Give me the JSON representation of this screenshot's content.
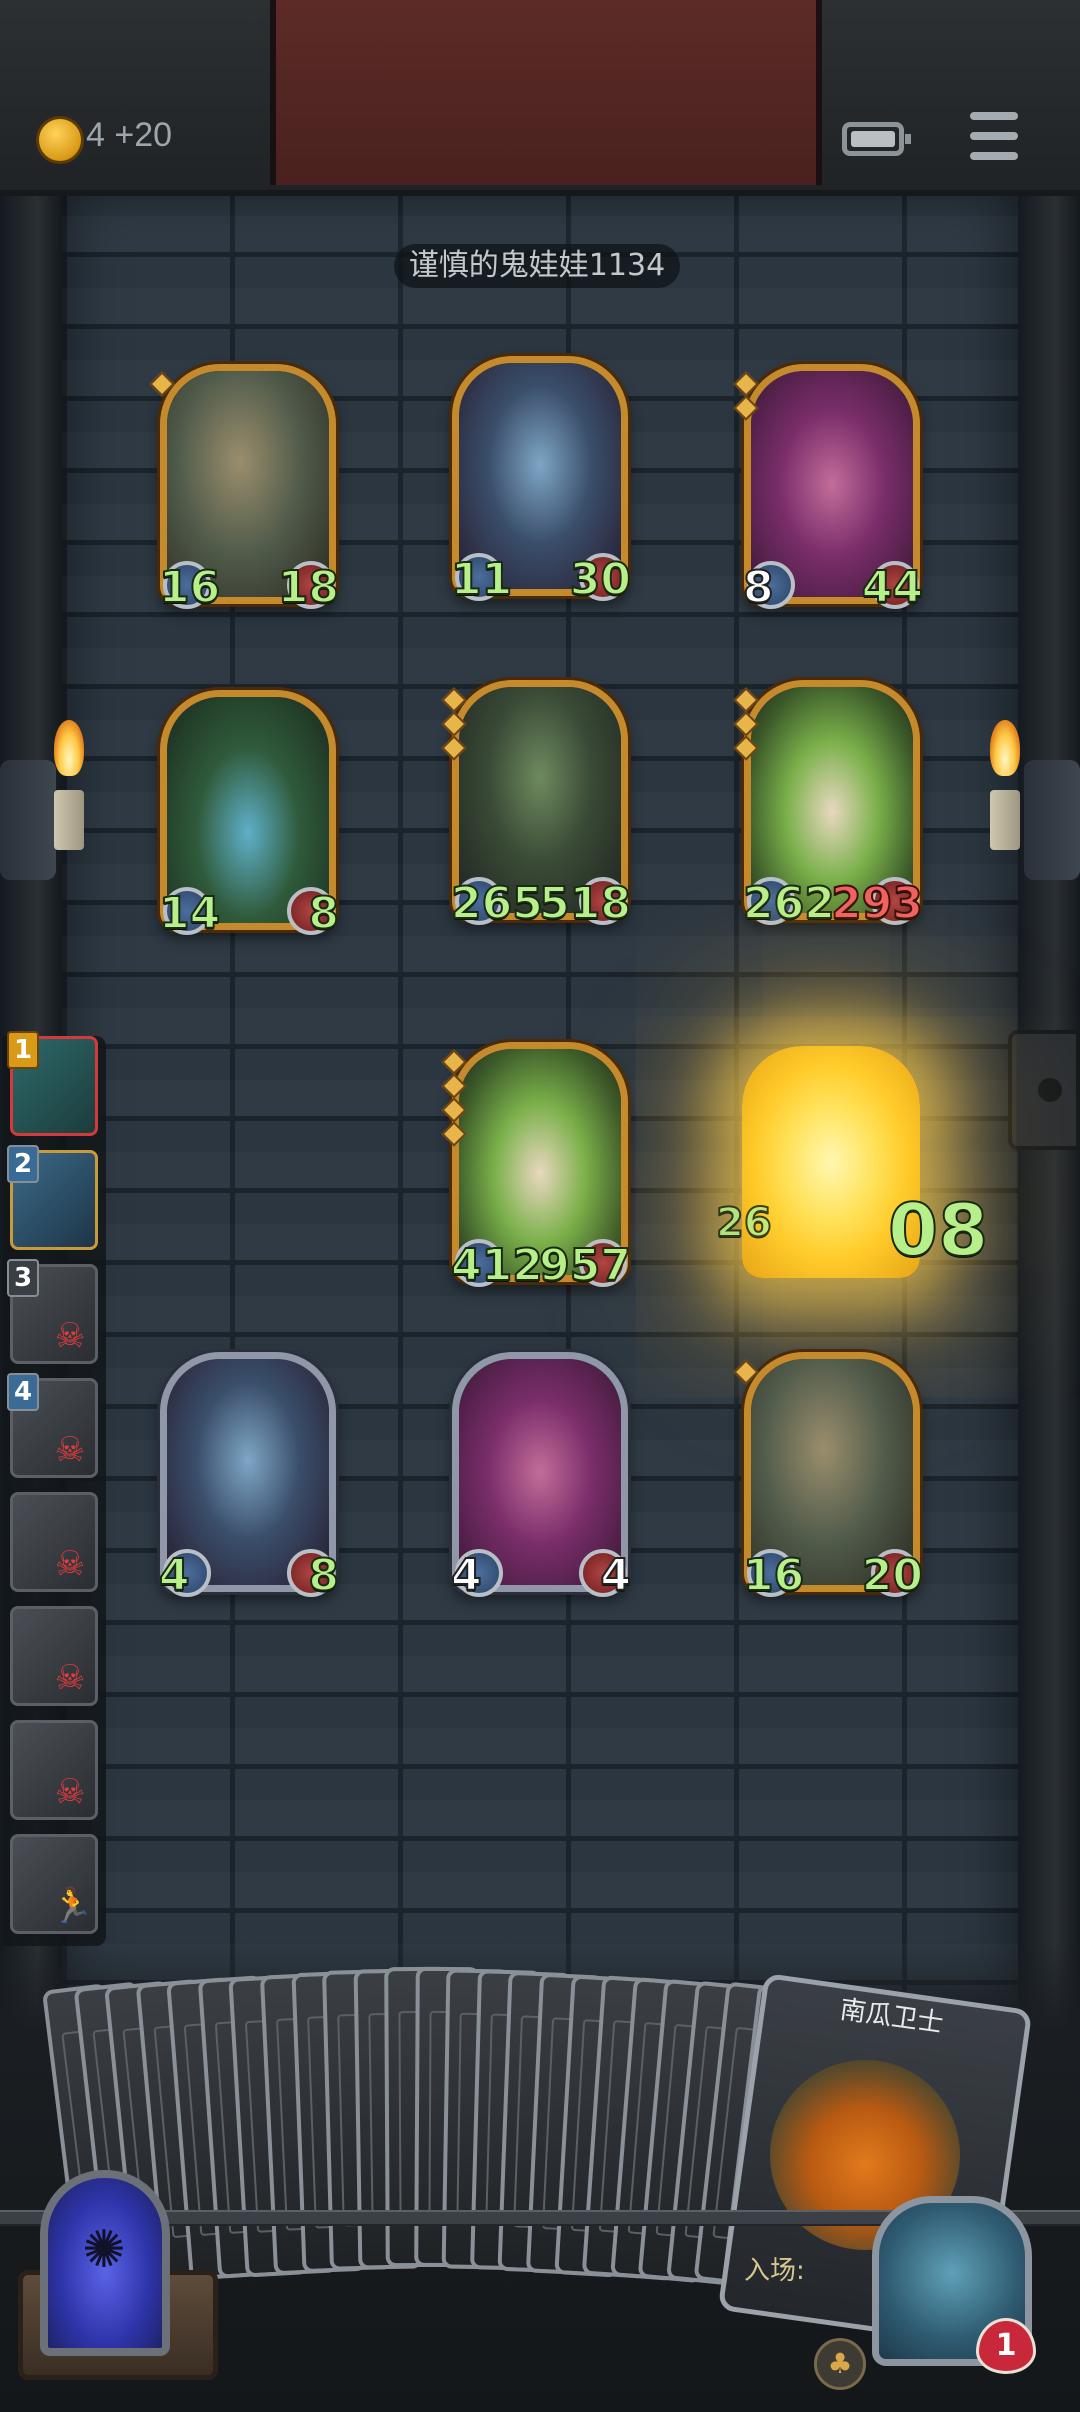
{
  "header": {
    "coins": "4",
    "coin_bonus": "+20",
    "icons": [
      "coin-icon",
      "battery-icon",
      "menu-icon"
    ]
  },
  "opponent": {
    "name": "谨慎的鬼娃娃1134"
  },
  "enemy_board": {
    "cards": [
      {
        "art": "mushroom-spider",
        "atk": "16",
        "hp": "18",
        "stars": 1,
        "hp_color": "green",
        "atk_color": "green"
      },
      {
        "art": "blue-elf",
        "atk": "11",
        "hp": "30",
        "stars": 0,
        "hp_color": "green",
        "atk_color": "green"
      },
      {
        "art": "clown",
        "atk": "8",
        "hp": "44",
        "stars": 2,
        "hp_color": "green",
        "atk_color": "white"
      },
      {
        "art": "vine-skull",
        "atk": "14",
        "hp": "8",
        "stars": 0,
        "hp_color": "green",
        "atk_color": "green"
      },
      {
        "art": "fanged-plant",
        "atk": "265",
        "hp": "518",
        "stars": 3,
        "hp_color": "green",
        "atk_color": "green"
      },
      {
        "art": "leaf-girl",
        "atk": "262",
        "hp": "293",
        "stars": 3,
        "hp_color": "red",
        "atk_color": "green"
      }
    ]
  },
  "player_board": {
    "cards": [
      {
        "art": "leaf-girl",
        "atk": "412",
        "hp": "957",
        "stars": 4,
        "hp_color": "green",
        "atk_color": "green"
      },
      {
        "art": "glowing-card",
        "atk": "26",
        "hp": "08",
        "stars": 0,
        "hp_color": "green",
        "atk_color": "green"
      },
      {
        "art": "blue-elf",
        "atk": "4",
        "hp": "8",
        "stars": 0,
        "hp_color": "green",
        "atk_color": "green"
      },
      {
        "art": "clown",
        "atk": "4",
        "hp": "4",
        "stars": 0,
        "hp_color": "white",
        "atk_color": "white"
      },
      {
        "art": "mushroom-spider",
        "atk": "16",
        "hp": "20",
        "stars": 1,
        "hp_color": "green",
        "atk_color": "green"
      }
    ]
  },
  "ranking": {
    "items": [
      {
        "rank": "1",
        "status": "alive"
      },
      {
        "rank": "2",
        "status": "alive"
      },
      {
        "rank": "3",
        "status": "dead"
      },
      {
        "rank": "4",
        "status": "dead"
      },
      {
        "rank": "",
        "status": "dead"
      },
      {
        "rank": "",
        "status": "dead"
      },
      {
        "rank": "",
        "status": "dead"
      },
      {
        "rank": "",
        "status": "fled"
      }
    ]
  },
  "hand": {
    "deck_card_count": 24,
    "featured_card": {
      "title": "南瓜卫士",
      "entry_label": "入场:"
    }
  },
  "hero": {
    "lives": "1"
  },
  "colors": {
    "gold_frame": "#c58a2c",
    "silver_frame": "#8f97a8",
    "stat_green": "#b7f08a",
    "stat_red": "#f06060",
    "wall": "#2b3640"
  }
}
